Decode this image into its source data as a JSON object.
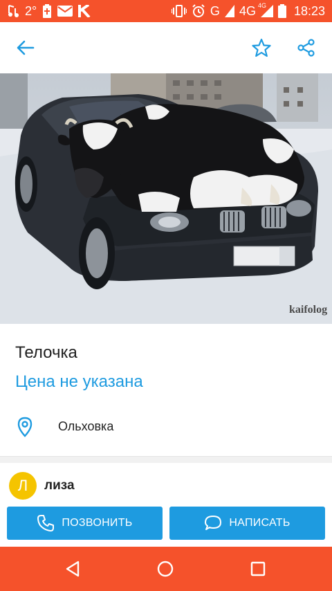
{
  "status_bar": {
    "notif_count": "2",
    "notif_unit": "°",
    "network_label": "G",
    "network_4g": "4G",
    "network_4g_small": "4G",
    "time": "18:23"
  },
  "listing": {
    "title": "Телочка",
    "price": "Цена не указана",
    "location": "Ольховка",
    "photo_watermark": "kaifolog"
  },
  "seller": {
    "initial": "Л",
    "name": "лиза"
  },
  "actions": {
    "call_label": "ПОЗВОНИТЬ",
    "write_label": "НАПИСАТЬ"
  },
  "colors": {
    "accent": "#1e9be0",
    "system_bar": "#f5522b",
    "avatar": "#f5c400"
  },
  "icons": [
    "back-arrow-icon",
    "star-icon",
    "share-icon",
    "location-pin-icon",
    "phone-icon",
    "chat-bubble-icon",
    "nav-back-icon",
    "nav-home-icon",
    "nav-recent-icon"
  ]
}
